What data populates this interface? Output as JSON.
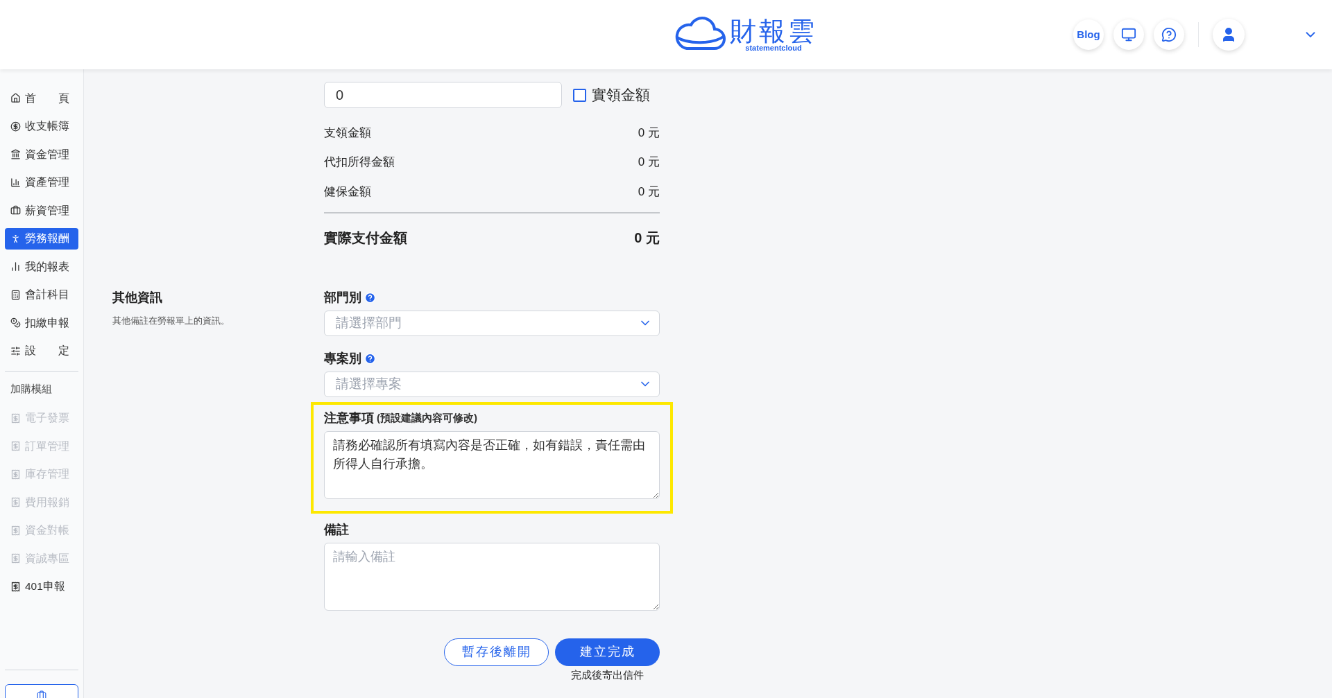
{
  "header": {
    "logo": {
      "name": "財報雲",
      "tagline": "statementcloud"
    },
    "actions": [
      {
        "kind": "text",
        "label": "Blog"
      },
      {
        "kind": "video"
      },
      {
        "kind": "help"
      }
    ]
  },
  "sidebar": {
    "items": [
      {
        "label": "首　　頁",
        "selected": false
      },
      {
        "label": "收支帳簿",
        "selected": false
      },
      {
        "label": "資金管理",
        "selected": false
      },
      {
        "label": "資產管理",
        "selected": false
      },
      {
        "label": "薪資管理",
        "selected": false
      },
      {
        "label": "勞務報酬",
        "selected": true
      },
      {
        "label": "我的報表",
        "selected": false
      },
      {
        "label": "會計科目",
        "selected": false
      },
      {
        "label": "扣繳申報",
        "selected": false
      },
      {
        "label": "設　　定",
        "selected": false
      }
    ],
    "addon_title": "加購模組",
    "addons": [
      {
        "label": "電子發票",
        "disabled": true
      },
      {
        "label": "訂單管理",
        "disabled": true
      },
      {
        "label": "庫存管理",
        "disabled": true
      },
      {
        "label": "費用報銷",
        "disabled": true
      },
      {
        "label": "資金對帳",
        "disabled": true
      },
      {
        "label": "資誠專區",
        "disabled": true
      },
      {
        "label": "401申報",
        "disabled": false
      }
    ],
    "bottom_button": {
      "kind": "subscription"
    }
  },
  "payment": {
    "value": "0",
    "checkbox": {
      "label": "實領金額",
      "checked": false
    }
  },
  "amounts": [
    {
      "label": "支領金額",
      "amount": "0 元"
    },
    {
      "label": "代扣所得金額",
      "amount": "0 元"
    },
    {
      "label": "健保金額",
      "amount": "0 元"
    }
  ],
  "total": {
    "label": "實際支付金額",
    "amount": "0 元"
  },
  "section": {
    "title": "其他資訊",
    "description": "其他備註在勞報單上的資訊。"
  },
  "fields": [
    {
      "kind": "select",
      "label": "部門別",
      "help": true,
      "placeholder": "請選擇部門",
      "highlighted": false
    },
    {
      "kind": "select",
      "label": "專案別",
      "help": true,
      "placeholder": "請選擇專案",
      "highlighted": false
    },
    {
      "kind": "textarea",
      "label": "注意事項",
      "help": false,
      "hint": "(預設建議內容可修改)",
      "value": "請務必確認所有填寫內容是否正確，如有錯誤，責任需由所得人自行承擔。",
      "highlighted": true
    },
    {
      "kind": "textarea",
      "label": "備註",
      "help": false,
      "placeholder": "請輸入備註",
      "highlighted": false
    }
  ],
  "buttons": [
    {
      "kind": "secondary",
      "label": "暫存後離開"
    },
    {
      "kind": "primary",
      "label": "建立完成",
      "caption": "完成後寄出信件"
    }
  ]
}
